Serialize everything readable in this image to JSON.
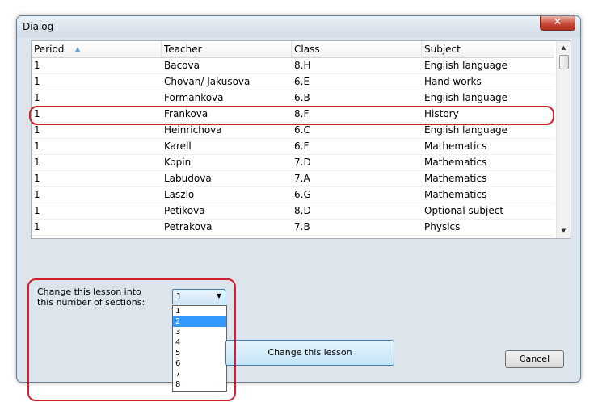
{
  "window": {
    "title": "Dialog",
    "close_icon": "close-icon"
  },
  "grid": {
    "columns": [
      "Period",
      "Teacher",
      "Class",
      "Subject"
    ],
    "sort_column": "Period",
    "rows": [
      [
        "1",
        "Bacova",
        "8.H",
        "English language"
      ],
      [
        "1",
        "Chovan/ Jakusova",
        "6.E",
        "Hand works"
      ],
      [
        "1",
        "Formankova",
        "6.B",
        "English language"
      ],
      [
        "1",
        "Frankova",
        "8.F",
        "History"
      ],
      [
        "1",
        "Heinrichova",
        "6.C",
        "English language"
      ],
      [
        "1",
        "Karell",
        "6.F",
        "Mathematics"
      ],
      [
        "1",
        "Kopin",
        "7.D",
        "Mathematics"
      ],
      [
        "1",
        "Labudova",
        "7.A",
        "Mathematics"
      ],
      [
        "1",
        "Laszlo",
        "6.G",
        "Mathematics"
      ],
      [
        "1",
        "Petikova",
        "8.D",
        "Optional subject"
      ],
      [
        "1",
        "Petrakova",
        "7.B",
        "Physics"
      ]
    ]
  },
  "sections": {
    "label": "Change this lesson into this number of sections:",
    "selected_value": "1",
    "options": [
      "1",
      "2",
      "3",
      "4",
      "5",
      "6",
      "7",
      "8"
    ],
    "highlighted_option": "2"
  },
  "buttons": {
    "change": "Change this lesson",
    "cancel": "Cancel"
  },
  "colors": {
    "annotation": "#d0202a",
    "highlight": "#3399ff"
  }
}
